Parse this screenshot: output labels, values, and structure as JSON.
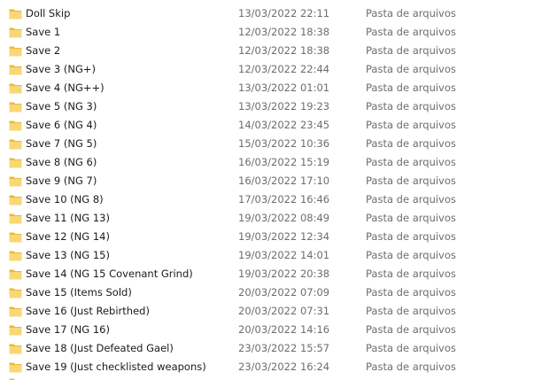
{
  "colors": {
    "folder_body": "#f8d775",
    "folder_tab": "#e9b93d",
    "name_text": "#1a1a1a",
    "meta_text": "#6d6d6d",
    "hover_bg": "#e5f3ff"
  },
  "icons": {
    "folder": "folder-icon"
  },
  "files": [
    {
      "name": "Doll Skip",
      "date": "13/03/2022 22:11",
      "type": "Pasta de arquivos"
    },
    {
      "name": "Save 1",
      "date": "12/03/2022 18:38",
      "type": "Pasta de arquivos"
    },
    {
      "name": "Save 2",
      "date": "12/03/2022 18:38",
      "type": "Pasta de arquivos"
    },
    {
      "name": "Save 3 (NG+)",
      "date": "12/03/2022 22:44",
      "type": "Pasta de arquivos"
    },
    {
      "name": "Save 4 (NG++)",
      "date": "13/03/2022 01:01",
      "type": "Pasta de arquivos"
    },
    {
      "name": "Save 5 (NG 3)",
      "date": "13/03/2022 19:23",
      "type": "Pasta de arquivos"
    },
    {
      "name": "Save 6 (NG 4)",
      "date": "14/03/2022 23:45",
      "type": "Pasta de arquivos"
    },
    {
      "name": "Save 7 (NG 5)",
      "date": "15/03/2022 10:36",
      "type": "Pasta de arquivos"
    },
    {
      "name": "Save 8 (NG 6)",
      "date": "16/03/2022 15:19",
      "type": "Pasta de arquivos"
    },
    {
      "name": "Save 9 (NG 7)",
      "date": "16/03/2022 17:10",
      "type": "Pasta de arquivos"
    },
    {
      "name": "Save 10 (NG 8)",
      "date": "17/03/2022 16:46",
      "type": "Pasta de arquivos"
    },
    {
      "name": "Save 11 (NG 13)",
      "date": "19/03/2022 08:49",
      "type": "Pasta de arquivos"
    },
    {
      "name": "Save 12 (NG 14)",
      "date": "19/03/2022 12:34",
      "type": "Pasta de arquivos"
    },
    {
      "name": "Save 13 (NG 15)",
      "date": "19/03/2022 14:01",
      "type": "Pasta de arquivos"
    },
    {
      "name": "Save 14 (NG 15 Covenant Grind)",
      "date": "19/03/2022 20:38",
      "type": "Pasta de arquivos"
    },
    {
      "name": "Save 15 (Items Sold)",
      "date": "20/03/2022 07:09",
      "type": "Pasta de arquivos"
    },
    {
      "name": "Save 16 (Just Rebirthed)",
      "date": "20/03/2022 07:31",
      "type": "Pasta de arquivos"
    },
    {
      "name": "Save 17 (NG 16)",
      "date": "20/03/2022 14:16",
      "type": "Pasta de arquivos"
    },
    {
      "name": "Save 18 (Just Defeated Gael)",
      "date": "23/03/2022 15:57",
      "type": "Pasta de arquivos"
    },
    {
      "name": "Save 19 (Just checklisted weapons)",
      "date": "23/03/2022 16:24",
      "type": "Pasta de arquivos"
    }
  ]
}
